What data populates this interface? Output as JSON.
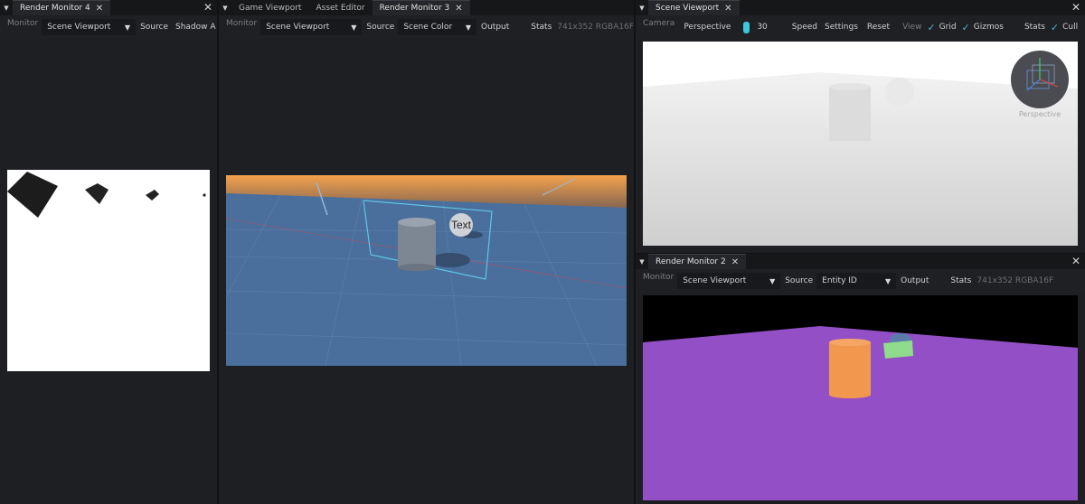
{
  "panel4": {
    "tab_label": "Render Monitor 4",
    "monitor_label": "Monitor",
    "source_value": "Scene Viewport",
    "source_label": "Source",
    "source2_value": "Shadow A"
  },
  "panel3": {
    "tabs": [
      {
        "label": "Game Viewport"
      },
      {
        "label": "Asset Editor"
      },
      {
        "label": "Render Monitor 3"
      }
    ],
    "monitor_label": "Monitor",
    "monitor_value": "Scene Viewport",
    "source_label": "Source",
    "source_value": "Scene Color",
    "output_label": "Output",
    "stats_label": "Stats",
    "stats_value": "741x352 RGBA16F",
    "billboard_text": "Text"
  },
  "scene_viewport": {
    "tab_label": "Scene Viewport",
    "camera_label": "Camera",
    "camera_value": "Perspective",
    "fov_value": "30",
    "speed_label": "Speed",
    "settings_label": "Settings",
    "reset_label": "Reset",
    "view_label": "View",
    "grid_label": "Grid",
    "gizmos_label": "Gizmos",
    "stats_label": "Stats",
    "cull_label": "Cull",
    "gizmo_caption": "Perspective"
  },
  "panel2": {
    "tab_label": "Render Monitor 2",
    "monitor_label": "Monitor",
    "monitor_value": "Scene Viewport",
    "source_label": "Source",
    "source_value": "Entity ID",
    "output_label": "Output",
    "stats_label": "Stats",
    "stats_value": "741x352 RGBA16F"
  },
  "colors": {
    "accent": "#3ec7d8",
    "entity_floor": "#9350c6",
    "entity_cylinder": "#f2984e",
    "entity_box": "#8fdc8c"
  }
}
